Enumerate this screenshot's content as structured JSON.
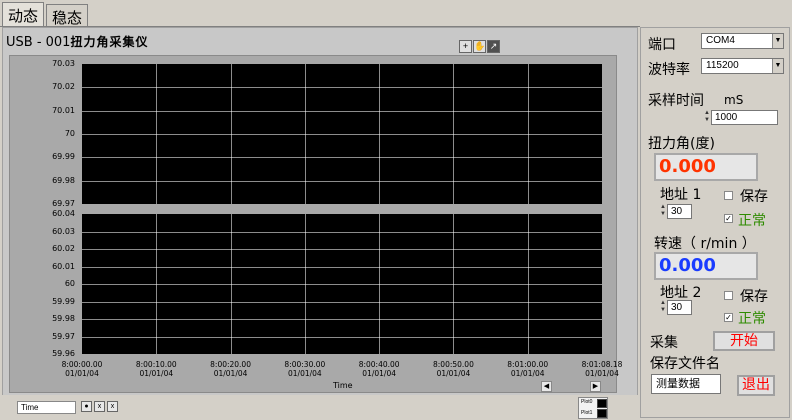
{
  "tabs": [
    {
      "label": "动态"
    },
    {
      "label": "稳态"
    }
  ],
  "title": {
    "prefix": "USB - 001",
    "suffix": "扭力角采集仪"
  },
  "graph": {
    "x_axis_label": "Time",
    "x_ticks": [
      {
        "time": "8:00:00.00",
        "date": "01/01/04"
      },
      {
        "time": "8:00:10.00",
        "date": "01/01/04"
      },
      {
        "time": "8:00:20.00",
        "date": "01/01/04"
      },
      {
        "time": "8:00:30.00",
        "date": "01/01/04"
      },
      {
        "time": "8:00:40.00",
        "date": "01/01/04"
      },
      {
        "time": "8:00:50.00",
        "date": "01/01/04"
      },
      {
        "time": "8:01:00.00",
        "date": "01/01/04"
      },
      {
        "time": "8:01:08.18",
        "date": "01/01/04"
      }
    ],
    "top_y_ticks": [
      "70.03",
      "70.02",
      "70.01",
      "70",
      "69.99",
      "69.98",
      "69.97"
    ],
    "bottom_y_ticks": [
      "60.04",
      "60.03",
      "60.02",
      "60.01",
      "60",
      "59.99",
      "59.98",
      "59.97",
      "59.96"
    ],
    "plot_bg": "#000000",
    "grid_color": "#ffffff",
    "time_field_value": "Time",
    "legend": [
      {
        "name": "Plot0"
      },
      {
        "name": "Plot1"
      }
    ]
  },
  "controls": {
    "port_label": "端口",
    "port_value": "COM4",
    "baud_label": "波特率",
    "baud_value": "115200",
    "sample_label": "采样时间",
    "sample_unit": "mS",
    "sample_value": "1000",
    "torque_label": "扭力角(度)",
    "torque_value": "0.000",
    "torque_color": "#ff3300",
    "addr1_label": "地址 1",
    "addr1_value": "30",
    "save1_label": "保存",
    "normal1_label": "正常",
    "speed_label": "转速（ r/min ）",
    "speed_value": "0.000",
    "speed_color": "#1a3cff",
    "addr2_label": "地址 2",
    "addr2_value": "30",
    "save2_label": "保存",
    "normal2_label": "正常",
    "normal_color": "#2e8b00",
    "collect_label": "采集",
    "start_label": "开始",
    "filename_label": "保存文件名",
    "filename_value": "测量数据",
    "exit_label": "退出"
  }
}
